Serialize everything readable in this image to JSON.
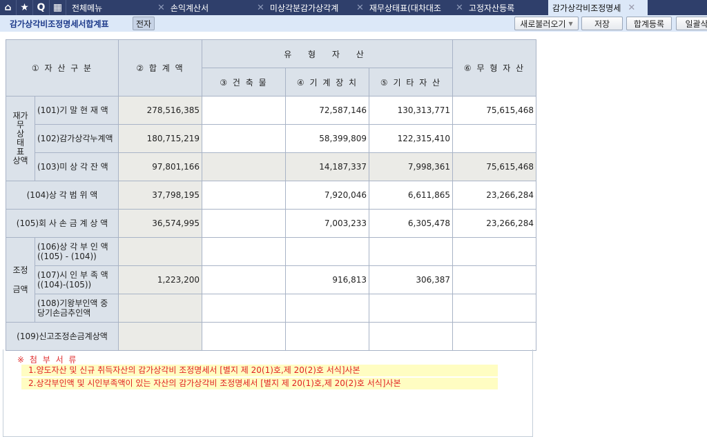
{
  "topbar": {
    "icons": [
      "home-icon",
      "star-icon",
      "search-icon",
      "menu-grid-icon"
    ],
    "menu_label": "전체메뉴",
    "tabs": [
      {
        "label": "손익계산서"
      },
      {
        "label": "미상각분감가상각계"
      },
      {
        "label": "재무상태표(대차대조"
      },
      {
        "label": "고정자산등록"
      },
      {
        "label": "감가상각비조정명세"
      }
    ]
  },
  "subbar": {
    "title": "감가상각비조정명세서합계표",
    "ejeon": "전자",
    "reload": "새로불러오기",
    "save": "저장",
    "sum_reg": "합계등록",
    "bulk": "일괄삭"
  },
  "table": {
    "headers": {
      "asset_class": "① 자 산 구 분",
      "total": "② 합 계 액",
      "tangible": "유 형 자 산",
      "building": "③ 건 축 물",
      "machinery": "④ 기 계 장 치",
      "other": "⑤ 기 타 자 산",
      "intangible": "⑥ 무 형 자 산"
    },
    "group_fs": "재가\n무\n상\n태\n표\n상액",
    "group_adj": "조정\n\n금액",
    "rows": [
      {
        "label": "(101)기 말 현 재 액",
        "total": "278,516,385",
        "building": "",
        "machinery": "72,587,146",
        "other": "130,313,771",
        "intangible": "75,615,468"
      },
      {
        "label": "(102)감가상각누계액",
        "total": "180,715,219",
        "building": "",
        "machinery": "58,399,809",
        "other": "122,315,410",
        "intangible": ""
      },
      {
        "label": "(103)미 상 각 잔 액",
        "total": "97,801,166",
        "building": "",
        "machinery": "14,187,337",
        "other": "7,998,361",
        "intangible": "75,615,468"
      },
      {
        "label": "(104)상 각  범 위 액",
        "total": "37,798,195",
        "building": "",
        "machinery": "7,920,046",
        "other": "6,611,865",
        "intangible": "23,266,284"
      },
      {
        "label": "(105)회 사 손 금 계 상 액",
        "total": "36,574,995",
        "building": "",
        "machinery": "7,003,233",
        "other": "6,305,478",
        "intangible": "23,266,284"
      },
      {
        "label": "(106)상 각 부 인 액\n((105) - (104))",
        "total": "",
        "building": "",
        "machinery": "",
        "other": "",
        "intangible": ""
      },
      {
        "label": "(107)시 인 부 족 액\n((104)-(105))",
        "total": "1,223,200",
        "building": "",
        "machinery": "916,813",
        "other": "306,387",
        "intangible": ""
      },
      {
        "label": "(108)기왕부인액 중\n당기손금추인액",
        "total": "",
        "building": "",
        "machinery": "",
        "other": "",
        "intangible": ""
      },
      {
        "label": "(109)신고조정손금계상액",
        "total": "",
        "building": "",
        "machinery": "",
        "other": "",
        "intangible": ""
      }
    ]
  },
  "notes": {
    "heading": "※ 첨 부 서 류",
    "items": [
      "1.양도자산 및 신규 취득자산의 감가상각비 조정명세서 [별지 제 20(1)호,제 20(2)호 서식]사본",
      "2.상각부인액 및 시인부족액이 있는 자산의 감가상각비 조정명세서 [별지 제 20(1)호,제 20(2)호 서식]사본"
    ]
  }
}
